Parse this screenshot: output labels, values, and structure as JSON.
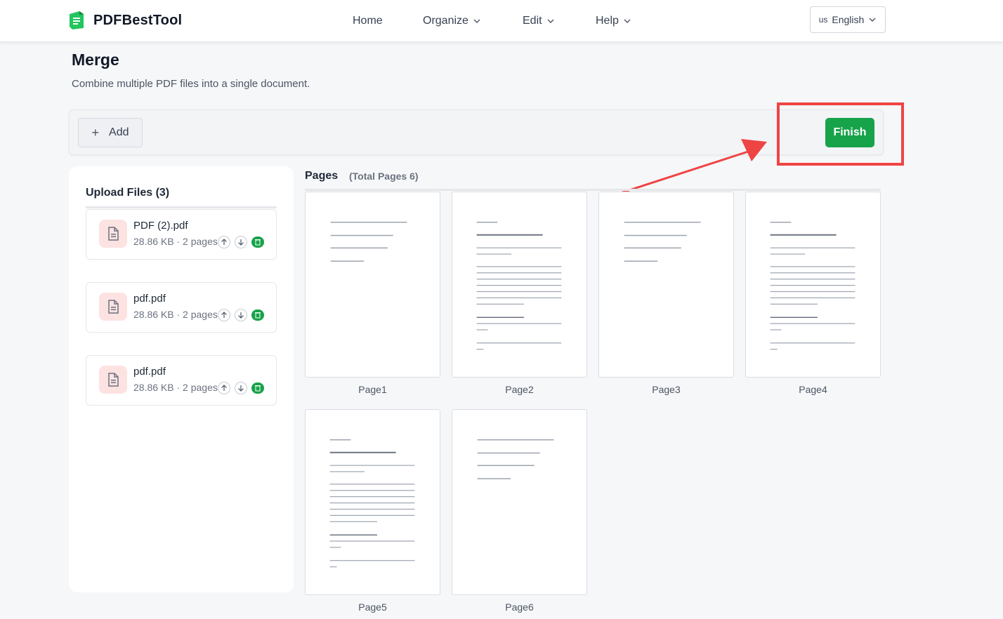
{
  "app": {
    "name": "PDFBestTool"
  },
  "nav": {
    "items": [
      {
        "label": "Home",
        "dropdown": false
      },
      {
        "label": "Organize",
        "dropdown": true
      },
      {
        "label": "Edit",
        "dropdown": true
      },
      {
        "label": "Help",
        "dropdown": true
      }
    ],
    "language": {
      "flag": "us",
      "label": "English"
    }
  },
  "page": {
    "title": "Merge",
    "subtitle": "Combine multiple PDF files into a single document."
  },
  "toolbar": {
    "add_label": "Add",
    "finish_label": "Finish"
  },
  "files": {
    "title": "Upload Files (3)",
    "items": [
      {
        "name": "PDF (2).pdf",
        "meta": "28.86 KB · 2 pages"
      },
      {
        "name": "pdf.pdf",
        "meta": "28.86 KB · 2 pages"
      },
      {
        "name": "pdf.pdf",
        "meta": "28.86 KB · 2 pages"
      }
    ]
  },
  "pages": {
    "label": "Pages",
    "total": "(Total Pages 6)",
    "items": [
      {
        "label": "Page1",
        "variant": "short"
      },
      {
        "label": "Page2",
        "variant": "long"
      },
      {
        "label": "Page3",
        "variant": "short"
      },
      {
        "label": "Page4",
        "variant": "long"
      },
      {
        "label": "Page5",
        "variant": "long"
      },
      {
        "label": "Page6",
        "variant": "short"
      }
    ]
  },
  "colors": {
    "accent": "#16a34a",
    "highlight": "#ef4444",
    "file_icon_bg": "#fde2e2"
  }
}
